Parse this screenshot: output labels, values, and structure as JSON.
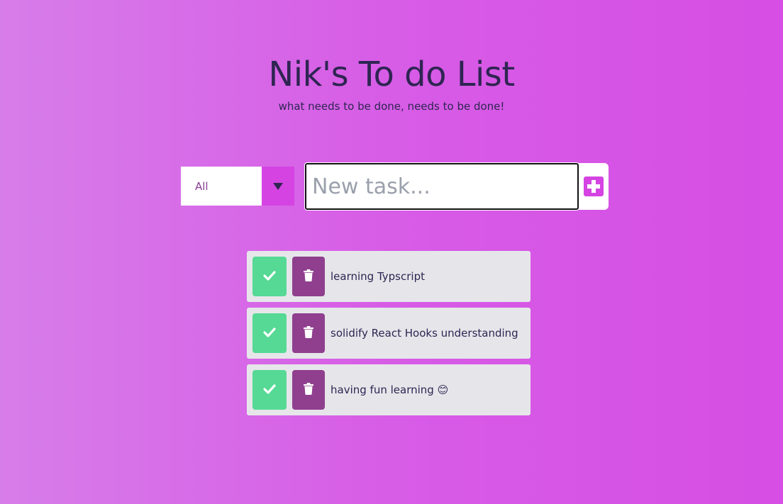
{
  "header": {
    "title": "Nik's To do List",
    "subtitle": "what needs to be done, needs to be done!"
  },
  "controls": {
    "filter_value": "All",
    "task_input_placeholder": "New task...",
    "task_input_value": ""
  },
  "todos": [
    {
      "text": "learning Typscript"
    },
    {
      "text": "solidify React Hooks understanding"
    },
    {
      "text": "having fun learning 😊"
    }
  ],
  "icons": {
    "filter_arrow": "caret-down-icon",
    "add": "plus-square-icon",
    "complete": "check-icon",
    "delete": "trash-icon"
  },
  "colors": {
    "background_start": "#d77de9",
    "background_end": "#d64ee4",
    "accent": "#d544e3",
    "complete_button": "#55d994",
    "delete_button": "#8f3f8e",
    "item_background": "#e6e6ea",
    "text": "#2e2552"
  }
}
